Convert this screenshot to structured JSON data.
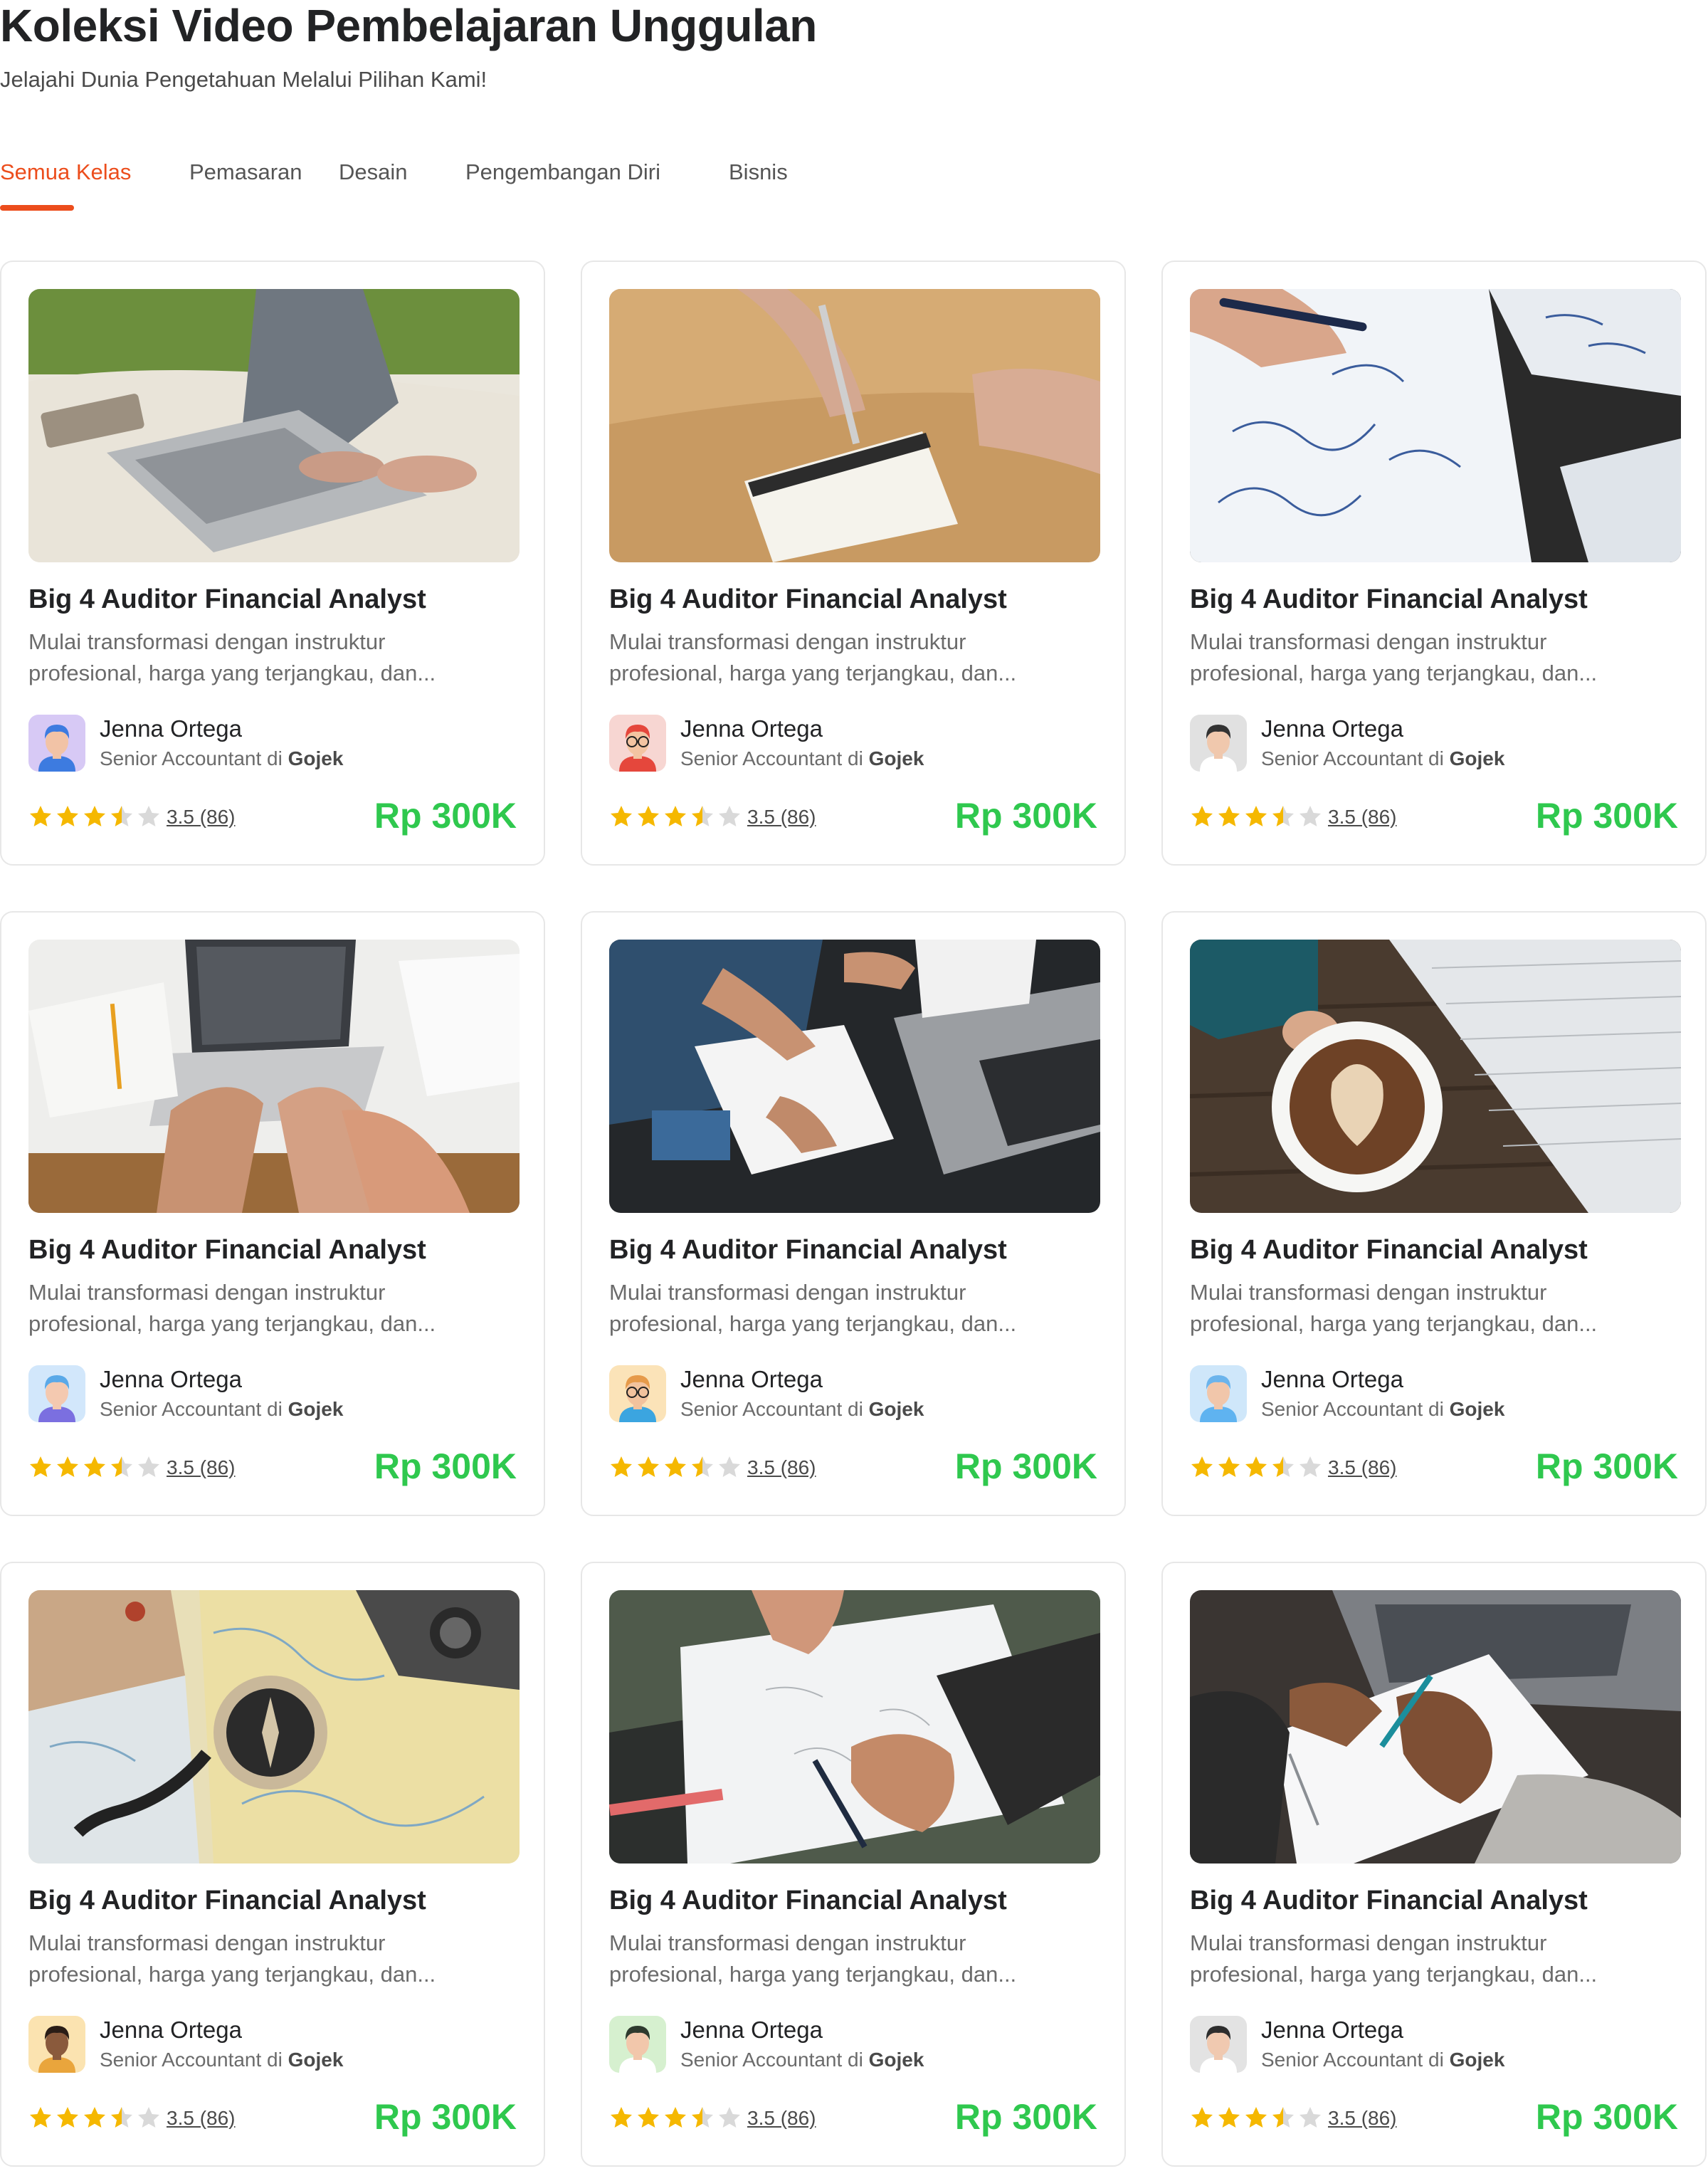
{
  "header": {
    "title": "Koleksi Video Pembelajaran Unggulan",
    "subtitle": "Jelajahi Dunia Pengetahuan Melalui Pilihan Kami!"
  },
  "tabs": [
    {
      "label": "Semua Kelas",
      "active": true
    },
    {
      "label": "Pemasaran",
      "active": false
    },
    {
      "label": "Desain",
      "active": false
    },
    {
      "label": "Pengembangan Diri",
      "active": false
    },
    {
      "label": "Bisnis",
      "active": false
    }
  ],
  "colors": {
    "accent": "#ec4d1c",
    "price": "#2fc84e",
    "star_filled": "#f5b800",
    "star_empty": "#d9d9d9"
  },
  "courses": [
    {
      "title": "Big 4 Auditor Financial Analyst",
      "description": "Mulai transformasi dengan instruktur profesional, harga yang terjangkau, dan...",
      "instructor_name": "Jenna Ortega",
      "instructor_role": "Senior Accountant di",
      "instructor_company": "Gojek",
      "rating": 3.5,
      "rating_text": "3.5 (86)",
      "price": "Rp 300K",
      "thumbnail": "laptop-on-blanket",
      "avatar": "avatar-blue-hair"
    },
    {
      "title": "Big 4 Auditor Financial Analyst",
      "description": "Mulai transformasi dengan instruktur profesional, harga yang terjangkau, dan...",
      "instructor_name": "Jenna Ortega",
      "instructor_role": "Senior Accountant di",
      "instructor_company": "Gojek",
      "rating": 3.5,
      "rating_text": "3.5 (86)",
      "price": "Rp 300K",
      "thumbnail": "writing-notepad",
      "avatar": "avatar-red-hair-glasses"
    },
    {
      "title": "Big 4 Auditor Financial Analyst",
      "description": "Mulai transformasi dengan instruktur profesional, harga yang terjangkau, dan...",
      "instructor_name": "Jenna Ortega",
      "instructor_role": "Senior Accountant di",
      "instructor_company": "Gojek",
      "rating": 3.5,
      "rating_text": "3.5 (86)",
      "price": "Rp 300K",
      "thumbnail": "math-notes",
      "avatar": "avatar-dark-hair"
    },
    {
      "title": "Big 4 Auditor Financial Analyst",
      "description": "Mulai transformasi dengan instruktur profesional, harga yang terjangkau, dan...",
      "instructor_name": "Jenna Ortega",
      "instructor_role": "Senior Accountant di",
      "instructor_company": "Gojek",
      "rating": 3.5,
      "rating_text": "3.5 (86)",
      "price": "Rp 300K",
      "thumbnail": "typing-laptop",
      "avatar": "avatar-blue-bob"
    },
    {
      "title": "Big 4 Auditor Financial Analyst",
      "description": "Mulai transformasi dengan instruktur profesional, harga yang terjangkau, dan...",
      "instructor_name": "Jenna Ortega",
      "instructor_role": "Senior Accountant di",
      "instructor_company": "Gojek",
      "rating": 3.5,
      "rating_text": "3.5 (86)",
      "price": "Rp 300K",
      "thumbnail": "desk-meeting",
      "avatar": "avatar-orange-glasses"
    },
    {
      "title": "Big 4 Auditor Financial Analyst",
      "description": "Mulai transformasi dengan instruktur profesional, harga yang terjangkau, dan...",
      "instructor_name": "Jenna Ortega",
      "instructor_role": "Senior Accountant di",
      "instructor_company": "Gojek",
      "rating": 3.5,
      "rating_text": "3.5 (86)",
      "price": "Rp 300K",
      "thumbnail": "coffee-notebook",
      "avatar": "avatar-bald-blue"
    },
    {
      "title": "Big 4 Auditor Financial Analyst",
      "description": "Mulai transformasi dengan instruktur profesional, harga yang terjangkau, dan...",
      "instructor_name": "Jenna Ortega",
      "instructor_role": "Senior Accountant di",
      "instructor_company": "Gojek",
      "rating": 3.5,
      "rating_text": "3.5 (86)",
      "price": "Rp 300K",
      "thumbnail": "map-compass",
      "avatar": "avatar-dark-skin"
    },
    {
      "title": "Big 4 Auditor Financial Analyst",
      "description": "Mulai transformasi dengan instruktur profesional, harga yang terjangkau, dan...",
      "instructor_name": "Jenna Ortega",
      "instructor_role": "Senior Accountant di",
      "instructor_company": "Gojek",
      "rating": 3.5,
      "rating_text": "3.5 (86)",
      "price": "Rp 300K",
      "thumbnail": "pen-paperwork",
      "avatar": "avatar-green-bg"
    },
    {
      "title": "Big 4 Auditor Financial Analyst",
      "description": "Mulai transformasi dengan instruktur profesional, harga yang terjangkau, dan...",
      "instructor_name": "Jenna Ortega",
      "instructor_role": "Senior Accountant di",
      "instructor_company": "Gojek",
      "rating": 3.5,
      "rating_text": "3.5 (86)",
      "price": "Rp 300K",
      "thumbnail": "writing-notebook",
      "avatar": "avatar-grey-bg"
    }
  ]
}
